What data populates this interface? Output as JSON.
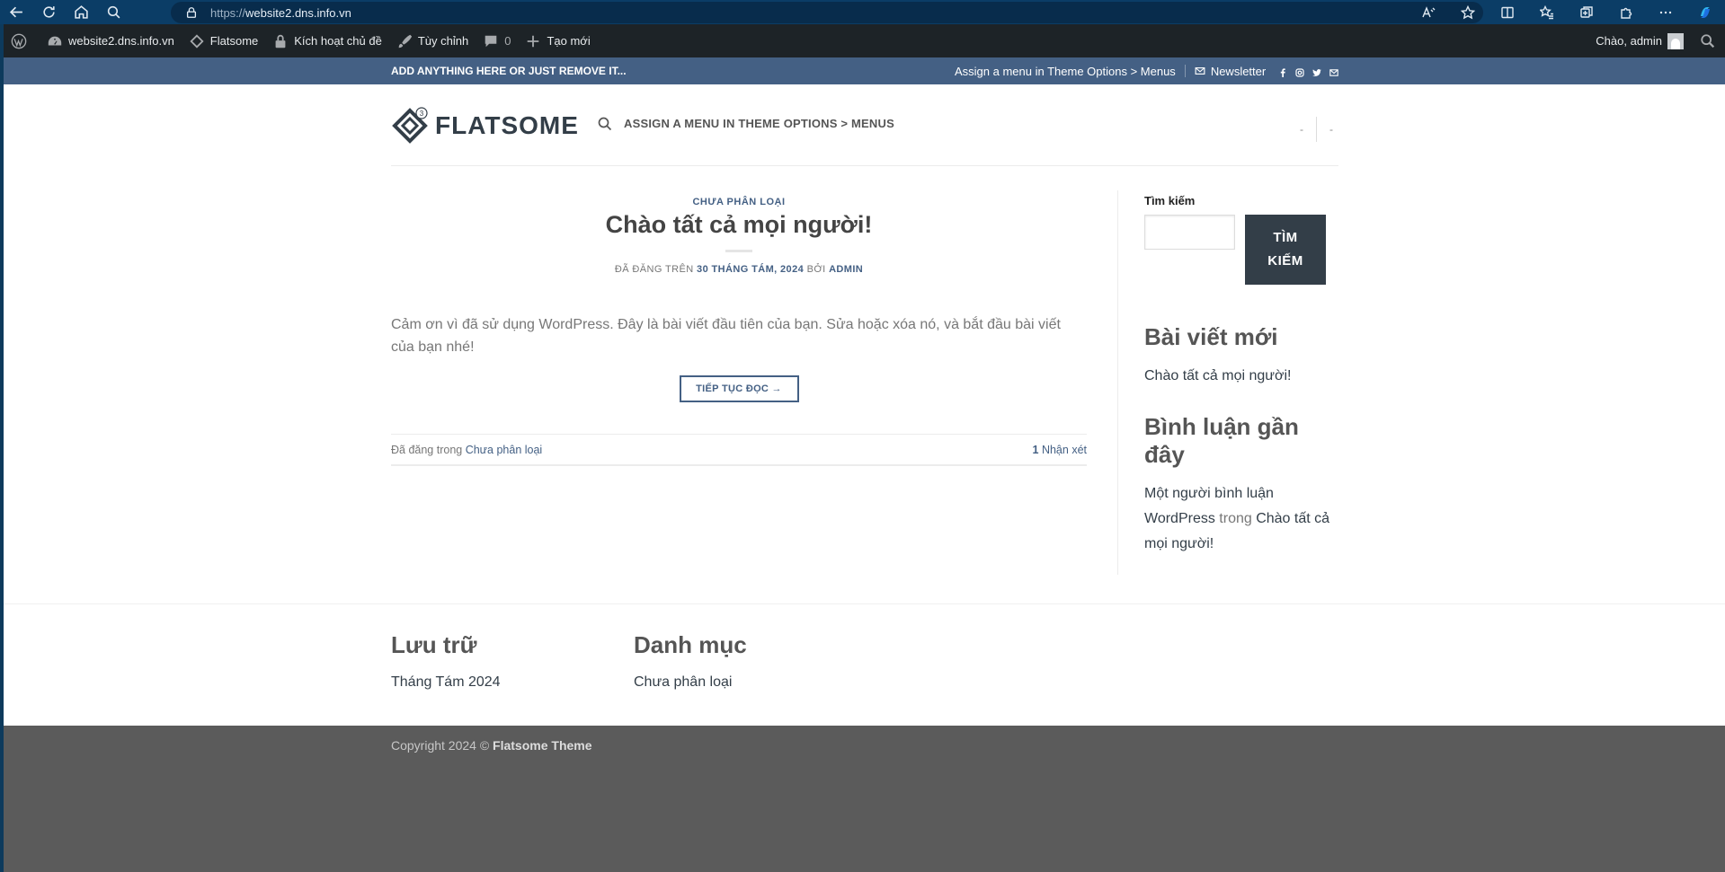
{
  "browser": {
    "url_proto": "https://",
    "url_host": "website2.dns.info.vn"
  },
  "admin_bar": {
    "site_name": "website2.dns.info.vn",
    "theme": "Flatsome",
    "activate": "Kích hoạt chủ đề",
    "customize": "Tùy chỉnh",
    "comments_count": "0",
    "new": "Tạo mới",
    "greeting": "Chào, admin"
  },
  "topbar": {
    "left_text": "ADD ANYTHING HERE OR JUST REMOVE IT...",
    "menu_hint": "Assign a menu in Theme Options > Menus",
    "newsletter": "Newsletter"
  },
  "header": {
    "logo_text": "FLATSOME",
    "logo_badge": "3",
    "menu_hint": "ASSIGN A MENU IN THEME OPTIONS > MENUS",
    "dash1": "-",
    "dash2": "-"
  },
  "post": {
    "category": "CHƯA PHÂN LOẠI",
    "title": "Chào tất cả mọi người!",
    "meta_prefix": "ĐÃ ĐĂNG TRÊN ",
    "meta_date": "30 THÁNG TÁM, 2024",
    "meta_by": " BỞI ",
    "meta_author": "ADMIN",
    "excerpt": "Cảm ơn vì đã sử dụng WordPress. Đây là bài viết đầu tiên của bạn. Sửa hoặc xóa nó, và bắt đầu bài viết của bạn nhé!",
    "read_more": "TIẾP TỤC ĐỌC →",
    "posted_in": "Đã đăng trong ",
    "posted_in_cat": "Chưa phân loại",
    "comments_count": "1",
    "comments_label": " Nhận xét"
  },
  "sidebar": {
    "search_label": "Tìm kiếm",
    "search_button": "TÌM KIẾM",
    "recent_title": "Bài viết mới",
    "recent_post": "Chào tất cả mọi người!",
    "comments_title": "Bình luận gần đây",
    "comment_author": "Một người bình luận WordPress",
    "comment_on": " trong ",
    "comment_post": "Chào tất cả mọi người!"
  },
  "footer": {
    "archive_title": "Lưu trữ",
    "archive_item": "Tháng Tám 2024",
    "category_title": "Danh mục",
    "category_item": "Chưa phân loại",
    "copyright_prefix": "Copyright 2024 © ",
    "copyright_brand": "Flatsome Theme"
  },
  "colors": {
    "primary": "#446084",
    "dark": "#333e48",
    "admin_bar": "#1d2327",
    "footer_bg": "#5b5b5b"
  }
}
